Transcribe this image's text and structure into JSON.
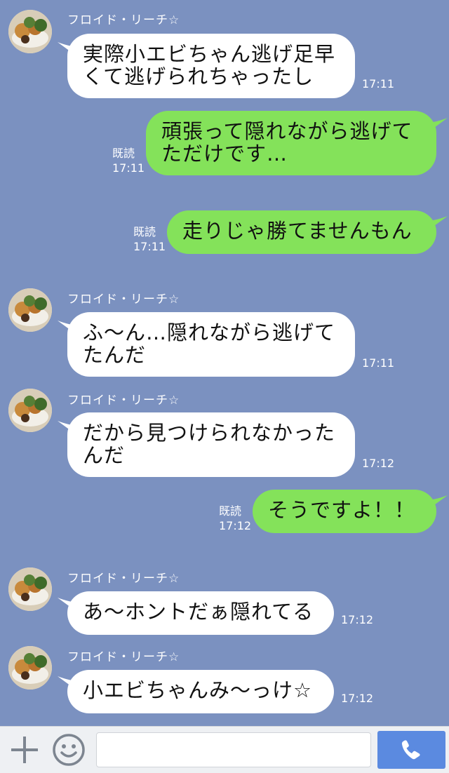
{
  "sender_name": "フロイド・リーチ☆",
  "read_label": "既読",
  "messages": [
    {
      "side": "in",
      "lines": [
        "実際小エビちゃん逃げ足早",
        "くて逃げられちゃったし"
      ],
      "time": "17:11"
    },
    {
      "side": "out",
      "lines": [
        "頑張って隠れながら逃げて",
        "ただけです…"
      ],
      "time": "17:11",
      "read": "既読"
    },
    {
      "side": "out",
      "lines": [
        "走りじゃ勝てませんもん"
      ],
      "time": "17:11",
      "read": "既読"
    },
    {
      "side": "in",
      "lines": [
        "ふ〜ん…隠れながら逃げて",
        "たんだ"
      ],
      "time": "17:11"
    },
    {
      "side": "in",
      "lines": [
        "だから見つけられなかった",
        "んだ"
      ],
      "time": "17:12"
    },
    {
      "side": "out",
      "lines": [
        "そうですよ！！"
      ],
      "time": "17:12",
      "read": "既読"
    },
    {
      "side": "in",
      "lines": [
        "あ〜ホントだぁ隠れてる"
      ],
      "time": "17:12"
    },
    {
      "side": "in",
      "lines": [
        "小エビちゃんみ〜っけ☆"
      ],
      "time": "17:12"
    }
  ],
  "toolbar": {
    "plus_icon": "plus-icon",
    "emoji_icon": "smiley-icon",
    "call_icon": "phone-icon",
    "input_placeholder": ""
  },
  "colors": {
    "background": "#7b91c0",
    "incoming_bubble": "#ffffff",
    "outgoing_bubble": "#84e25a",
    "call_button": "#5b8ae0"
  }
}
